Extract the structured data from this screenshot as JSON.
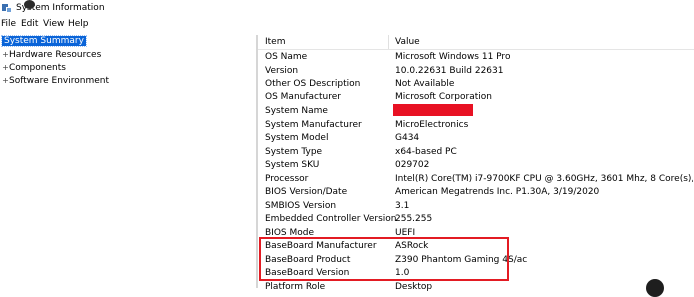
{
  "window": {
    "title": "System Information"
  },
  "menu": [
    "File",
    "Edit",
    "View",
    "Help"
  ],
  "tree": [
    {
      "label": "System Summary",
      "expander": "",
      "selected": true
    },
    {
      "label": "Hardware Resources",
      "expander": "+",
      "selected": false
    },
    {
      "label": "Components",
      "expander": "+",
      "selected": false
    },
    {
      "label": "Software Environment",
      "expander": "+",
      "selected": false
    }
  ],
  "list": {
    "headers": {
      "item": "Item",
      "value": "Value"
    },
    "rows": [
      {
        "item": "OS Name",
        "value": "Microsoft Windows 11 Pro"
      },
      {
        "item": "Version",
        "value": "10.0.22631 Build 22631"
      },
      {
        "item": "Other OS Description",
        "value": "Not Available"
      },
      {
        "item": "OS Manufacturer",
        "value": "Microsoft Corporation"
      },
      {
        "item": "System Name",
        "value": ""
      },
      {
        "item": "System Manufacturer",
        "value": "MicroElectronics"
      },
      {
        "item": "System Model",
        "value": "G434"
      },
      {
        "item": "System Type",
        "value": "x64-based PC"
      },
      {
        "item": "System SKU",
        "value": "029702"
      },
      {
        "item": "Processor",
        "value": "Intel(R) Core(TM) i7-9700KF CPU @ 3.60GHz, 3601 Mhz, 8 Core(s), 8 Logical P..."
      },
      {
        "item": "BIOS Version/Date",
        "value": "American Megatrends Inc. P1.30A, 3/19/2020"
      },
      {
        "item": "SMBIOS Version",
        "value": "3.1"
      },
      {
        "item": "Embedded Controller Version",
        "value": "255.255"
      },
      {
        "item": "BIOS Mode",
        "value": "UEFI"
      },
      {
        "item": "BaseBoard Manufacturer",
        "value": "ASRock"
      },
      {
        "item": "BaseBoard Product",
        "value": "Z390 Phantom Gaming 4S/ac"
      },
      {
        "item": "BaseBoard Version",
        "value": "1.0"
      },
      {
        "item": "Platform Role",
        "value": "Desktop"
      }
    ]
  },
  "colors": {
    "selection": "#0a64d8",
    "highlight_border": "#e31b23",
    "redaction": "#e81123"
  }
}
